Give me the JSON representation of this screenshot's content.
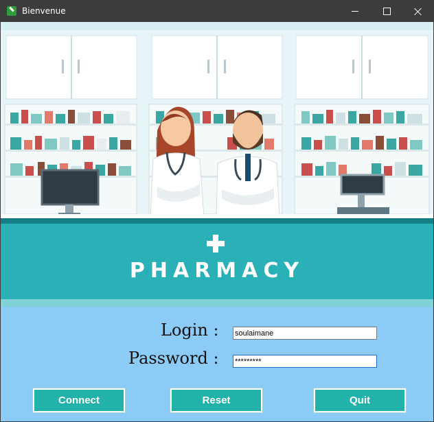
{
  "window": {
    "title": "Bienvenue",
    "icon": "pharmacy-app-icon"
  },
  "banner": {
    "title": "PHARMACY",
    "cross_symbol": "+"
  },
  "form": {
    "login_label": "Login :",
    "login_value": "soulaimane",
    "password_label": "Password :",
    "password_value": "*********"
  },
  "buttons": {
    "connect": "Connect",
    "reset": "Reset",
    "quit": "Quit"
  },
  "colors": {
    "accent": "#22b2aa",
    "form_background": "#8ccbf5",
    "banner_teal": "#2ab0b7"
  }
}
